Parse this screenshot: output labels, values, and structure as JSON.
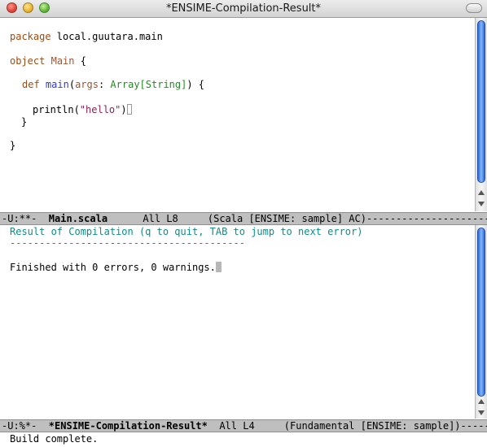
{
  "window": {
    "title": "*ENSIME-Compilation-Result*"
  },
  "editor": {
    "package_kw": "package",
    "package_name": " local.guutara.main",
    "object_kw": "object",
    "object_name": "Main",
    "object_brace": " {",
    "def_kw": "def",
    "def_name": "main",
    "paren_open": "(",
    "arg_name": "args",
    "colon": ": ",
    "arg_type": "Array[String]",
    "def_tail": ") {",
    "println_head": "println(",
    "println_str": "\"hello\"",
    "println_tail": ")",
    "inner_close": "}",
    "outer_close": "}"
  },
  "modeline_top": {
    "status": "-U:**-  ",
    "buffer": "Main.scala",
    "position": "      All L8     ",
    "mode": "(Scala [ENSIME: sample] AC)",
    "fill": "----------------------------------------"
  },
  "compilation": {
    "header": "Result of Compilation (q to quit, TAB to jump to next error)",
    "separator": "----------------------------------------",
    "result": "Finished with 0 errors, 0 warnings."
  },
  "modeline_bottom": {
    "status": "-U:%*-  ",
    "buffer": "*ENSIME-Compilation-Result*",
    "position": "  All L4     ",
    "mode": "(Fundamental [ENSIME: sample])",
    "fill": "-------------"
  },
  "echo": {
    "message": "Build complete."
  }
}
